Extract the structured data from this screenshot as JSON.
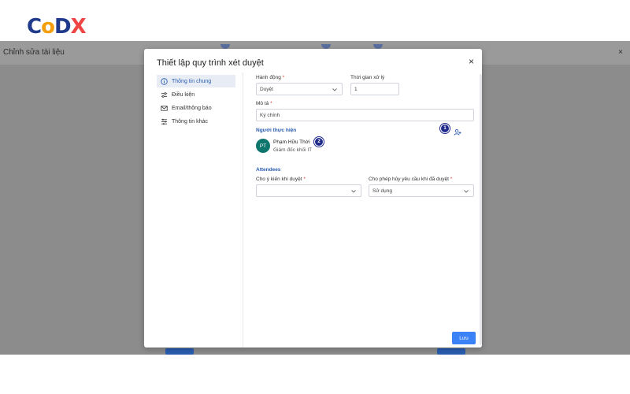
{
  "logo": {
    "c": "C",
    "o": "o",
    "d": "D",
    "x": "X"
  },
  "app": {
    "title": "Chỉnh sửa tài liệu",
    "close": "×"
  },
  "modal": {
    "title": "Thiết lập quy trình xét duyệt",
    "close": "×",
    "nav": [
      {
        "label": "Thông tin chung",
        "icon": "info-icon",
        "active": true
      },
      {
        "label": "Điều kiện",
        "icon": "sliders-icon"
      },
      {
        "label": "Email/thông báo",
        "icon": "mail-icon"
      },
      {
        "label": "Thông tin khác",
        "icon": "settings-icon"
      }
    ],
    "form": {
      "action_label": "Hành động",
      "action_value": "Duyệt",
      "time_label": "Thời gian xử lý",
      "time_value": "1",
      "desc_label": "Mô tả",
      "desc_value": "Ký chính",
      "performer_section": "Người thực hiện",
      "performer": {
        "initials": "PT",
        "name": "Phạm Hữu Thời",
        "role": "Giám đốc khối IT"
      },
      "badge1": "1",
      "badge2": "2",
      "attendees_section": "Attendees",
      "opinion_label": "Cho ý kiến khi duyệt",
      "opinion_value": "",
      "cancel_label": "Cho phép hủy yêu cầu khi đã duyệt",
      "cancel_value": "Sử dụng",
      "required_mark": "*"
    },
    "save_label": "Lưu"
  },
  "colors": {
    "accent": "#2a5db0",
    "primary_button": "#3b82f6",
    "avatar": "#0f766e",
    "badge": "#1f2a8a"
  }
}
